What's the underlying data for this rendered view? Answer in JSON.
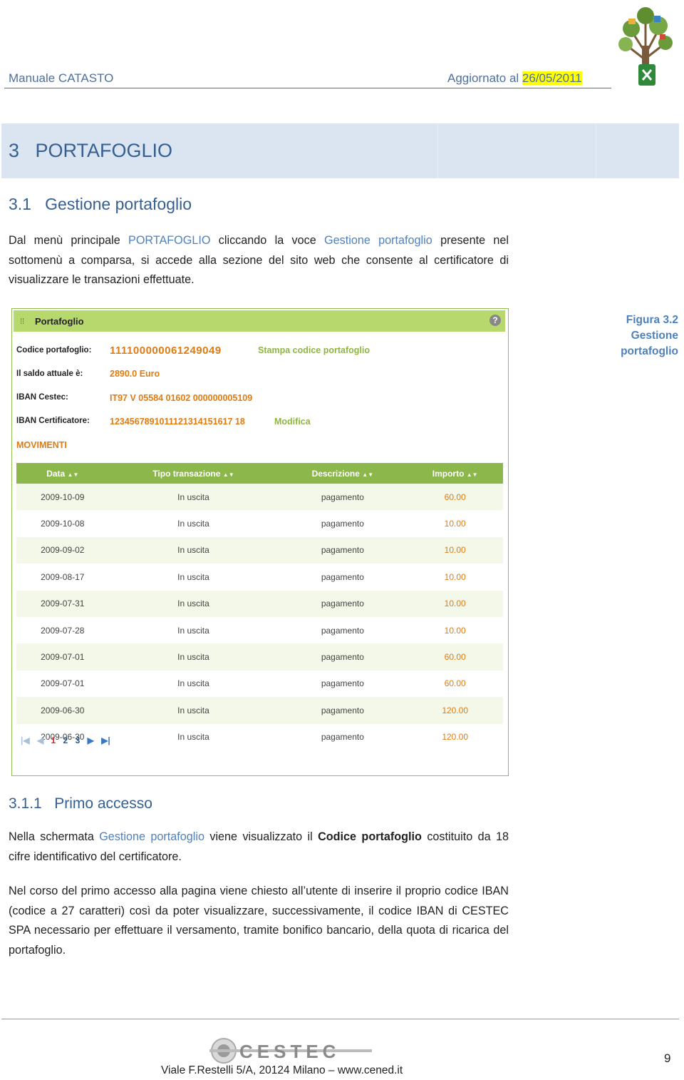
{
  "header": {
    "left": "Manuale CATASTO",
    "right_prefix": "Aggiornato al ",
    "right_date": "26/05/2011"
  },
  "chapter": {
    "title": "3   PORTAFOGLIO"
  },
  "section": {
    "title": "3.1   Gestione portafoglio"
  },
  "intro": {
    "p1": "Dal menù principale ",
    "p1_highlight1": "PORTAFOGLIO",
    "p2": " cliccando la voce ",
    "p2_highlight2": "Gestione portafoglio",
    "p3": " presente nel sottomenù a comparsa, si accede alla sezione del sito web che consente al certificatore di visualizzare le transazioni effettuate."
  },
  "figure": {
    "caption_line1": "Figura 3.2",
    "caption_line2": "Gestione portafoglio"
  },
  "app": {
    "title": "Portafoglio",
    "help": "?",
    "labels": {
      "codice": "Codice portafoglio:",
      "saldo": "Il saldo attuale è:",
      "iban_cestec": "IBAN Cestec:",
      "iban_cert": "IBAN Certificatore:"
    },
    "values": {
      "codice": "111100000061249049",
      "saldo": "2890.0 Euro",
      "iban_cestec": "IT97 V 05584 01602 000000005109",
      "iban_cert": "1234567891011121314151617 18"
    },
    "links": {
      "stampa": "Stampa codice portafoglio",
      "modifica": "Modifica"
    },
    "movimenti": "MOVIMENTI",
    "table": {
      "headers": [
        "Data",
        "Tipo transazione",
        "Descrizione",
        "Importo"
      ],
      "rows": [
        [
          "2009-10-09",
          "In uscita",
          "pagamento",
          "60.00"
        ],
        [
          "2009-10-08",
          "In uscita",
          "pagamento",
          "10.00"
        ],
        [
          "2009-09-02",
          "In uscita",
          "pagamento",
          "10.00"
        ],
        [
          "2009-08-17",
          "In uscita",
          "pagamento",
          "10.00"
        ],
        [
          "2009-07-31",
          "In uscita",
          "pagamento",
          "10.00"
        ],
        [
          "2009-07-28",
          "In uscita",
          "pagamento",
          "10.00"
        ],
        [
          "2009-07-01",
          "In uscita",
          "pagamento",
          "60.00"
        ],
        [
          "2009-07-01",
          "In uscita",
          "pagamento",
          "60.00"
        ],
        [
          "2009-06-30",
          "In uscita",
          "pagamento",
          "120.00"
        ],
        [
          "2009-06-30",
          "In uscita",
          "pagamento",
          "120.00"
        ]
      ]
    },
    "pager": {
      "pages": [
        "1",
        "2",
        "3"
      ],
      "current": "1"
    }
  },
  "subsection": {
    "title": "3.1.1   Primo accesso"
  },
  "body": {
    "b1_a": "Nella schermata ",
    "b1_hl": "Gestione portafoglio",
    "b1_b": " viene visualizzato il ",
    "b1_bold": "Codice portafoglio",
    "b1_c": " costituito da 18 cifre identificativo del certificatore.",
    "b2": "Nel corso del primo accesso alla pagina viene chiesto all’utente di inserire il proprio codice IBAN (codice a 27 caratteri) così da poter visualizzare, successivamente, il codice IBAN di CESTEC SPA necessario per effettuare il versamento, tramite bonifico bancario, della quota di ricarica del portafoglio."
  },
  "footer": {
    "logo_text": "CESTEC",
    "address": "Viale F.Restelli 5/A, 20124 Milano – www.cened.it",
    "page": "9"
  }
}
